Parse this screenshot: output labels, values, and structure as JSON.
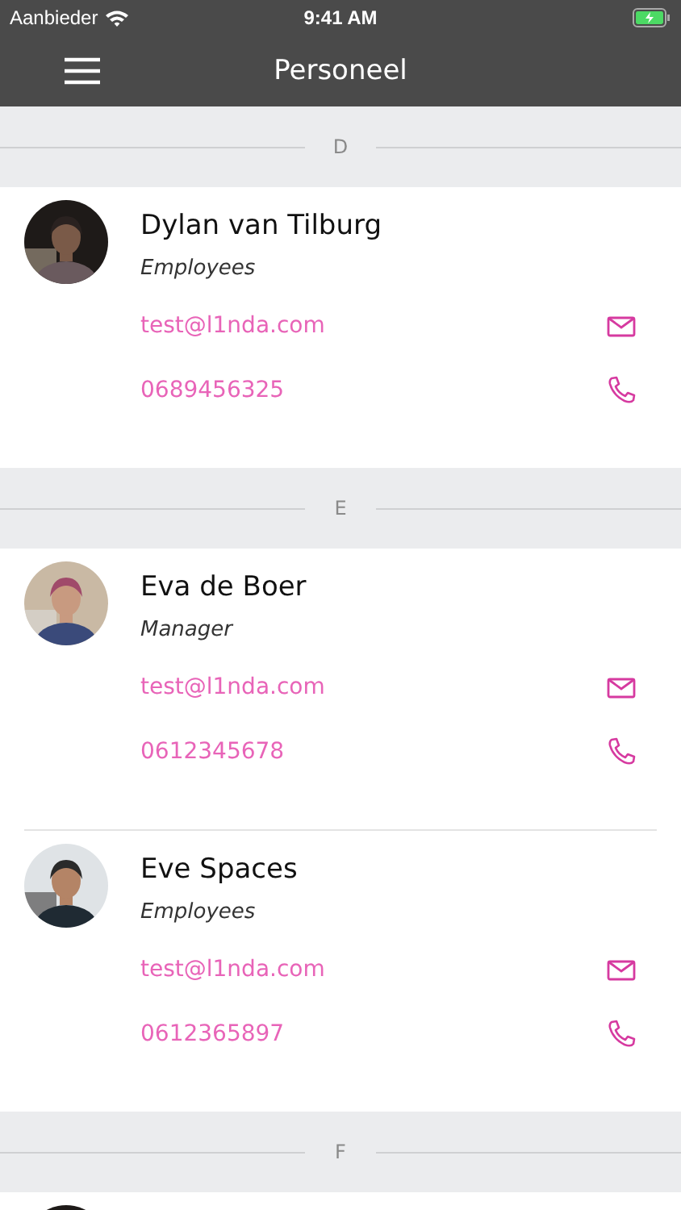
{
  "status_bar": {
    "carrier": "Aanbieder",
    "time": "9:41 AM"
  },
  "nav_bar": {
    "title": "Personeel"
  },
  "sections": [
    {
      "letter": "D",
      "contacts": [
        {
          "kind": "full",
          "name": "Dylan van Tilburg",
          "role": "Employees",
          "email": "test@l1nda.com",
          "phone": "0689456325"
        }
      ]
    },
    {
      "letter": "E",
      "contacts": [
        {
          "kind": "full",
          "name": "Eva de Boer",
          "role": "Manager",
          "email": "test@l1nda.com",
          "phone": "0612345678"
        },
        {
          "kind": "full",
          "name": "Eve Spaces",
          "role": "Employees",
          "email": "test@l1nda.com",
          "phone": "0612365897"
        }
      ]
    },
    {
      "letter": "F",
      "contacts": [
        {
          "kind": "cut_off"
        }
      ]
    }
  ]
}
